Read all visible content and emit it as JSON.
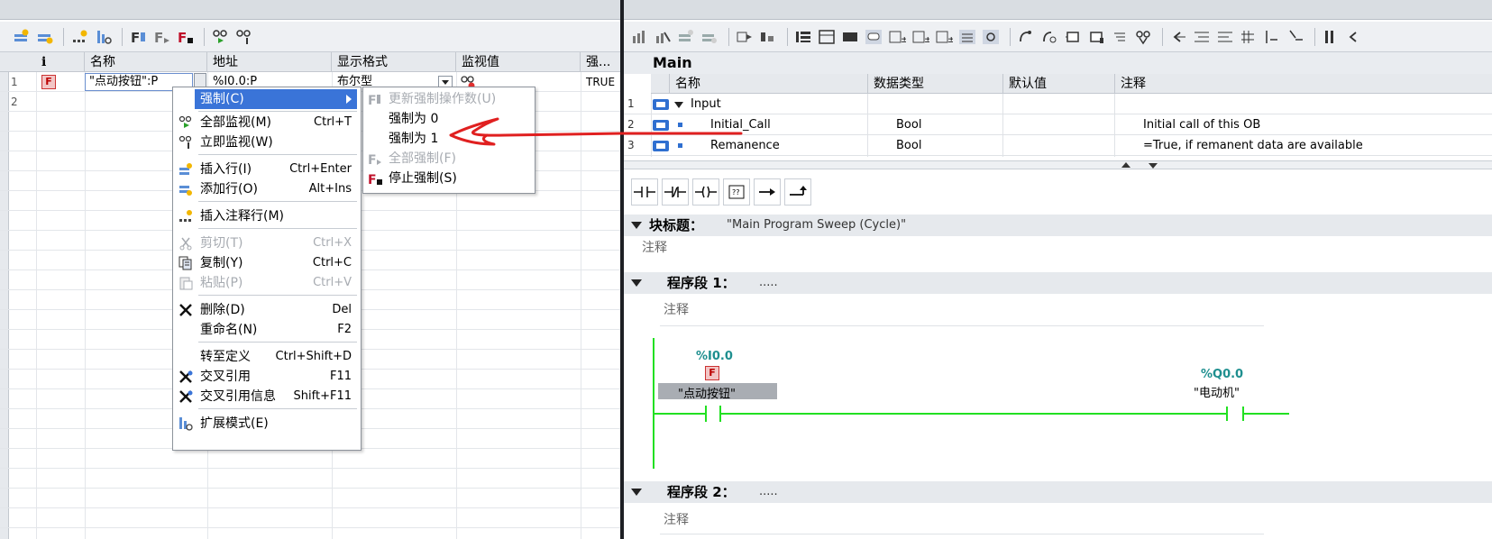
{
  "left": {
    "columns": [
      "i",
      "名称",
      "地址",
      "显示格式",
      "监视值",
      "强..."
    ],
    "rows": [
      {
        "num": "1",
        "badge": "F",
        "name": "\"点动按钮\":P",
        "address": "%I0.0:P",
        "format": "布尔型",
        "monitor": "",
        "force": "TRUE"
      },
      {
        "num": "2",
        "badge": "",
        "name": "",
        "address": "",
        "format": "",
        "monitor": "",
        "force": ""
      }
    ]
  },
  "context_menu": {
    "items": [
      {
        "label": "强制(C)",
        "shortcut": "",
        "state": "active"
      },
      {
        "label": "全部监视(M)",
        "shortcut": "Ctrl+T",
        "state": "normal"
      },
      {
        "label": "立即监视(W)",
        "shortcut": "",
        "state": "normal"
      },
      {
        "label": "插入行(I)",
        "shortcut": "Ctrl+Enter",
        "state": "normal"
      },
      {
        "label": "添加行(O)",
        "shortcut": "Alt+Ins",
        "state": "normal"
      },
      {
        "label": "插入注释行(M)",
        "shortcut": "",
        "state": "normal"
      },
      {
        "label": "剪切(T)",
        "shortcut": "Ctrl+X",
        "state": "disabled"
      },
      {
        "label": "复制(Y)",
        "shortcut": "Ctrl+C",
        "state": "normal"
      },
      {
        "label": "粘贴(P)",
        "shortcut": "Ctrl+V",
        "state": "disabled"
      },
      {
        "label": "删除(D)",
        "shortcut": "Del",
        "state": "normal"
      },
      {
        "label": "重命名(N)",
        "shortcut": "F2",
        "state": "normal"
      },
      {
        "label": "转至定义",
        "shortcut": "Ctrl+Shift+D",
        "state": "normal"
      },
      {
        "label": "交叉引用",
        "shortcut": "F11",
        "state": "normal"
      },
      {
        "label": "交叉引用信息",
        "shortcut": "Shift+F11",
        "state": "normal"
      },
      {
        "label": "扩展模式(E)",
        "shortcut": "",
        "state": "normal"
      }
    ]
  },
  "submenu": {
    "items": [
      {
        "label": "更新强制操作数(U)",
        "state": "disabled"
      },
      {
        "label": "强制为 0",
        "state": "normal"
      },
      {
        "label": "强制为 1",
        "state": "normal"
      },
      {
        "label": "全部强制(F)",
        "state": "disabled"
      },
      {
        "label": "停止强制(S)",
        "state": "normal"
      }
    ]
  },
  "right": {
    "block_title": "Main",
    "interface": {
      "columns": [
        "名称",
        "数据类型",
        "默认值",
        "注释"
      ],
      "rows": [
        {
          "num": "1",
          "name": "Input",
          "type": "",
          "default": "",
          "comment": ""
        },
        {
          "num": "2",
          "name": "Initial_Call",
          "type": "Bool",
          "default": "",
          "comment": "Initial call of this OB"
        },
        {
          "num": "3",
          "name": "Remanence",
          "type": "Bool",
          "default": "",
          "comment": "=True, if remanent data are available"
        }
      ]
    },
    "block_heading": {
      "label": "块标题：",
      "value": "\"Main Program Sweep (Cycle)\""
    },
    "comment_label": "注释",
    "network1": {
      "label": "程序段 1：",
      "value": ".....",
      "comment": "注释",
      "contact_addr": "%I0.0",
      "contact_badge": "F",
      "contact_name": "\"点动按钮\"",
      "coil_addr": "%Q0.0",
      "coil_name": "\"电动机\""
    },
    "network2": {
      "label": "程序段 2：",
      "value": ".....",
      "comment": "注释"
    }
  },
  "colors": {
    "rail": "#22e022",
    "menu_active": "#3a74d8",
    "annotation": "#e02020"
  }
}
